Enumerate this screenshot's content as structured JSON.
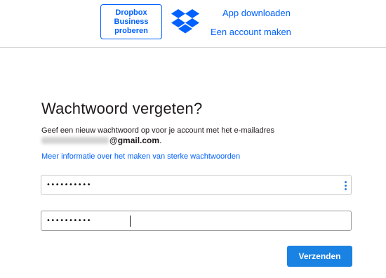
{
  "header": {
    "business_button": "Dropbox Business proberen",
    "logo_icon": "dropbox-logo-icon",
    "app_link": "App downloaden",
    "account_link": "Een account maken",
    "accent_color": "#0061fe"
  },
  "main": {
    "title": "Wachtwoord vergeten?",
    "description": "Geef een nieuw wachtwoord op voor je account met het e-mailadres",
    "email_domain": "@gmail.com",
    "email_suffix": ".",
    "info_link": "Meer informatie over het maken van sterke wachtwoorden",
    "new_password_value": "••••••••••",
    "confirm_password_value": "••••••••••",
    "password_menu_icon": "vertical-dots-icon",
    "submit_label": "Verzenden",
    "submit_color": "#1a82e2"
  }
}
